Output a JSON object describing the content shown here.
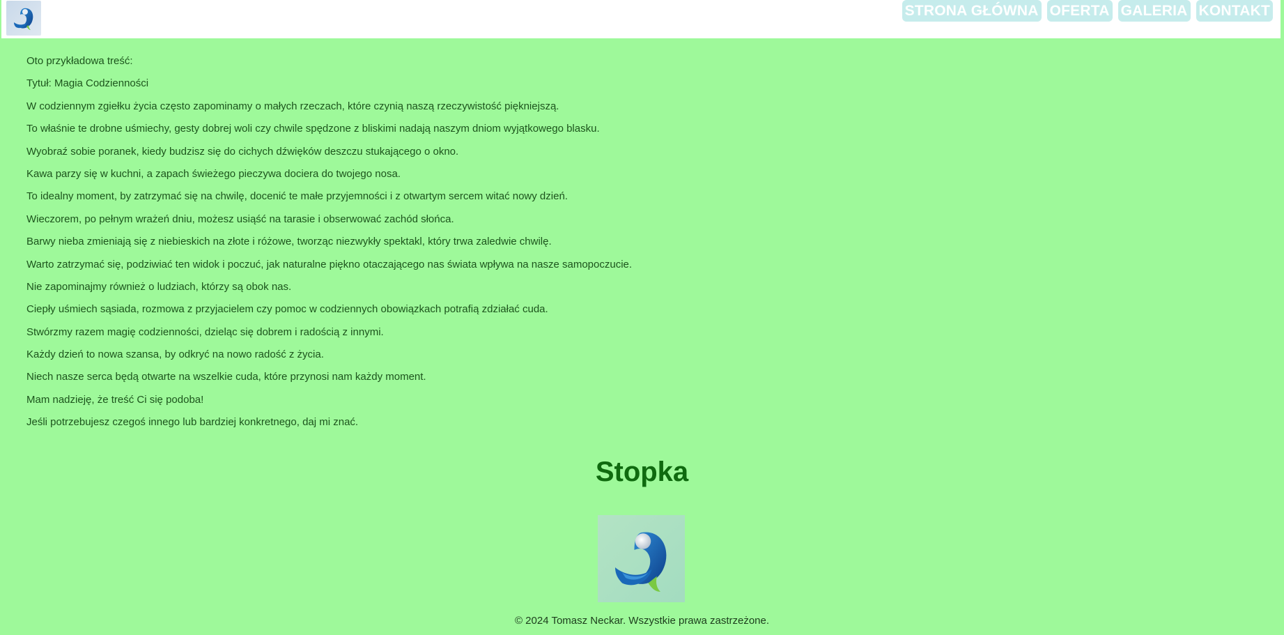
{
  "header": {
    "logo_icon": "bird-logo-icon",
    "nav": [
      {
        "label": "STRONA GŁÓWNA"
      },
      {
        "label": "OFERTA"
      },
      {
        "label": "GALERIA"
      },
      {
        "label": "KONTAKT"
      }
    ]
  },
  "content": {
    "paragraphs": [
      "Oto przykładowa treść:",
      "Tytuł: Magia Codzienności",
      "W codziennym zgiełku życia często zapominamy o małych rzeczach, które czynią naszą rzeczywistość piękniejszą.",
      "To właśnie te drobne uśmiechy, gesty dobrej woli czy chwile spędzone z bliskimi nadają naszym dniom wyjątkowego blasku.",
      "Wyobraź sobie poranek, kiedy budzisz się do cichych dźwięków deszczu stukającego o okno.",
      "Kawa parzy się w kuchni, a zapach świeżego pieczywa dociera do twojego nosa.",
      "To idealny moment, by zatrzymać się na chwilę, docenić te małe przyjemności i z otwartym sercem witać nowy dzień.",
      "Wieczorem, po pełnym wrażeń dniu, możesz usiąść na tarasie i obserwować zachód słońca.",
      "Barwy nieba zmieniają się z niebieskich na złote i różowe, tworząc niezwykły spektakl, który trwa zaledwie chwilę.",
      "Warto zatrzymać się, podziwiać ten widok i poczuć, jak naturalne piękno otaczającego nas świata wpływa na nasze samopoczucie.",
      "Nie zapominajmy również o ludziach, którzy są obok nas.",
      "Ciepły uśmiech sąsiada, rozmowa z przyjacielem czy pomoc w codziennych obowiązkach potrafią zdziałać cuda.",
      "Stwórzmy razem magię codzienności, dzieląc się dobrem i radością z innymi.",
      "Każdy dzień to nowa szansa, by odkryć na nowo radość z życia.",
      "Niech nasze serca będą otwarte na wszelkie cuda, które przynosi nam każdy moment.",
      "Mam nadzieję, że treść Ci się podoba!",
      "Jeśli potrzebujesz czegoś innego lub bardziej konkretnego, daj mi znać."
    ]
  },
  "footer": {
    "title": "Stopka",
    "logo_icon": "bird-logo-icon",
    "copyright": "© 2024 Tomasz Neckar. Wszystkie prawa zastrzeżone."
  },
  "colors": {
    "page_background": "#9ef99a",
    "header_background": "#ffffff",
    "nav_button_background": "#c6ecec",
    "text": "#1c541c",
    "footer_title": "#0f6a0f"
  }
}
